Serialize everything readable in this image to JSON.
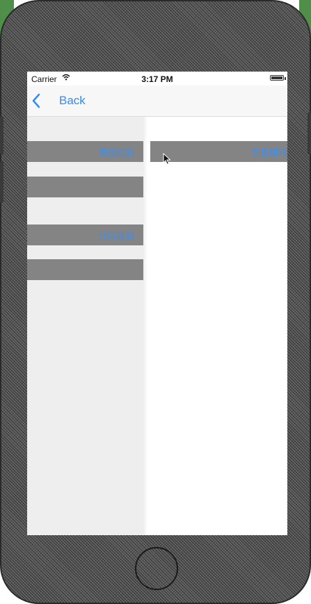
{
  "status_bar": {
    "carrier": "Carrier",
    "time": "3:17 PM"
  },
  "nav": {
    "back_label": "Back"
  },
  "left_panel": {
    "bars": [
      {
        "label": "页面跳转"
      },
      {
        "label": ""
      },
      {
        "label": "代码跳转"
      },
      {
        "label": ""
      }
    ]
  },
  "right_panel": {
    "bars": [
      {
        "label": "页面跳转"
      }
    ]
  },
  "colors": {
    "accent": "#2f8cf7",
    "bar": "#848484",
    "panel": "#eeeeee"
  }
}
